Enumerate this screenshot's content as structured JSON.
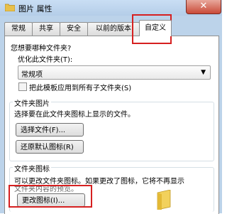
{
  "window": {
    "title": "图片 属性",
    "close_symbol": "✕"
  },
  "tabs": [
    {
      "label": "常规"
    },
    {
      "label": "共享"
    },
    {
      "label": "安全"
    },
    {
      "label": "以前的版本"
    },
    {
      "label": "自定义"
    }
  ],
  "sections": {
    "folder_type": {
      "question": "您想要哪种文件夹?",
      "optimize_label": "优化此文件夹(T):",
      "optimize_value": "常规项",
      "apply_subfolders_label": "把此模板应用到所有子文件夹(S)",
      "apply_subfolders_checked": false
    },
    "folder_pictures": {
      "title": "文件夹图片",
      "description": "选择要在此文件夹图标上显示的文件。",
      "choose_file_button": "选择文件(F)...",
      "restore_default_button": "还原默认图标(R)"
    },
    "folder_icons": {
      "title": "文件夹图标",
      "description_line1": "可以更改文件夹图标。如果更改了图标，它将不再显示",
      "description_line2": "文件夹内容的预览。",
      "change_icon_button": "更改图标(I)..."
    }
  },
  "highlight_color": "#d62020"
}
